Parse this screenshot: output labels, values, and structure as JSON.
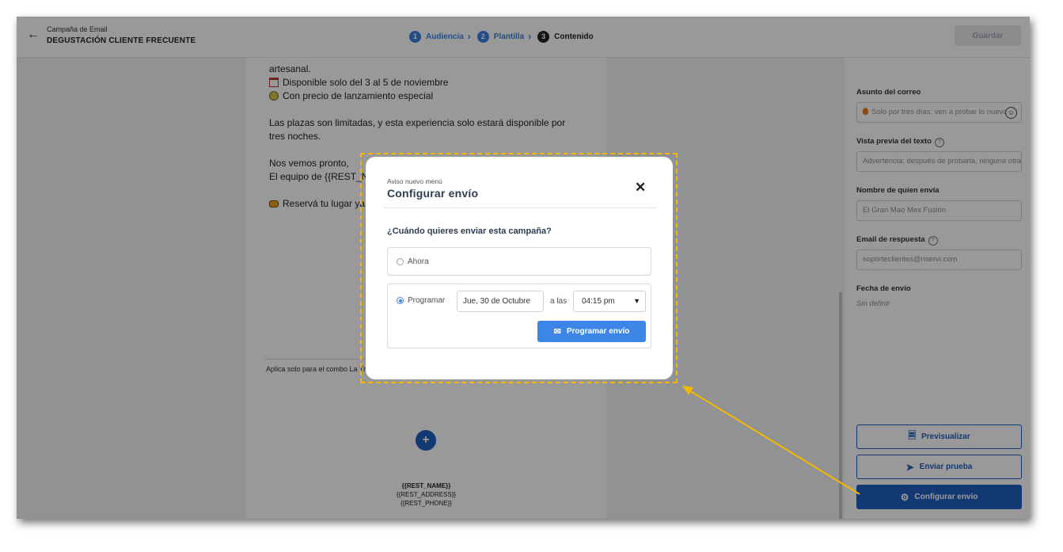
{
  "header": {
    "back_icon": "arrow-left-icon",
    "campaign_type": "Campaña de Email",
    "campaign_name": "DEGUSTACIÓN CLIENTE FRECUENTE",
    "steps": [
      {
        "number": "1",
        "label": "Audiencia"
      },
      {
        "number": "2",
        "label": "Plantilla"
      },
      {
        "number": "3",
        "label": "Contenido"
      }
    ],
    "save_label": "Guardar"
  },
  "email": {
    "lines": [
      "artesanal.",
      "Disponible solo del 3 al 5 de noviembre",
      "Con precio de lanzamiento especial",
      "Las plazas son limitadas, y esta experiencia solo estará disponible por",
      "tres noches.",
      "Nos vemos pronto,",
      "El equipo de {{REST_NAME}}",
      "Reservá tu lugar ya"
    ],
    "combo_note": "Aplica solo para el combo La Trilogía",
    "add_block_label": "+",
    "footer": {
      "name": "{{REST_NAME}}",
      "address": "{{REST_ADDRESS}}",
      "phone": "{{REST_PHONE}}"
    }
  },
  "panel": {
    "subject_label": "Asunto del correo",
    "subject_value": "Solo por tres días: ven a probar lo nuevo",
    "preview_label": "Vista previa del texto",
    "preview_value": "Advertencia: después de probarla, ninguna otra te sabrá igual",
    "sender_label": "Nombre de quien envía",
    "sender_value": "El Gran Mao Mex Fusión",
    "reply_label": "Email de respuesta",
    "reply_value": "soporteclientes@riservi.com",
    "send_date_label": "Fecha de envío",
    "send_date_value": "Sin definir",
    "buttons": {
      "preview": "Previsualizar",
      "test": "Enviar prueba",
      "configure": "Configurar envío"
    }
  },
  "modal": {
    "subtitle": "Aviso nuevo menú",
    "title": "Configurar envío",
    "question": "¿Cuándo quieres enviar esta campaña?",
    "option_now": "Ahora",
    "option_schedule": "Programar",
    "selected_option": "Programar",
    "date_value": "Jue, 30 de Octubre",
    "at_label": "a las",
    "time_value": "04:15 pm",
    "schedule_button": "Programar envío"
  },
  "colors": {
    "accent": "#3d7fe0",
    "primary_button": "#1f5fbf",
    "highlight": "#f5b800"
  }
}
